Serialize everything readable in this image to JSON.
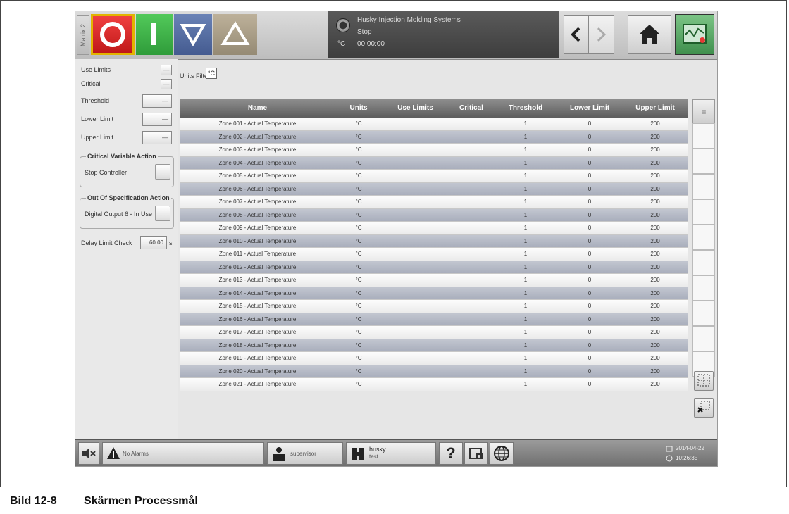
{
  "topbar": {
    "machine": "Matrix 2",
    "status_unit": "°C",
    "status_company": "Husky Injection Molding Systems",
    "status_state": "Stop",
    "status_time": "00:00:00"
  },
  "left": {
    "use_limits": "Use Limits",
    "critical": "Critical",
    "threshold": "Threshold",
    "lower_limit": "Lower Limit",
    "upper_limit": "Upper Limit",
    "dash": "—",
    "critical_action_title": "Critical Variable Action",
    "critical_action_value": "Stop Controller",
    "oos_action_title": "Out Of Specification Action",
    "oos_action_value": "Digital Output 6 - In Use",
    "delay_label": "Delay Limit Check",
    "delay_value": "60.00",
    "delay_unit": "s"
  },
  "filter": {
    "label": "Units Filter",
    "value": "°C"
  },
  "table": {
    "headers": [
      "Name",
      "Units",
      "Use Limits",
      "Critical",
      "Threshold",
      "Lower Limit",
      "Upper Limit"
    ],
    "rows": [
      {
        "name": "Zone 001 - Actual Temperature",
        "units": "°C",
        "threshold": "1",
        "lower": "0",
        "upper": "200"
      },
      {
        "name": "Zone 002 - Actual Temperature",
        "units": "°C",
        "threshold": "1",
        "lower": "0",
        "upper": "200"
      },
      {
        "name": "Zone 003 - Actual Temperature",
        "units": "°C",
        "threshold": "1",
        "lower": "0",
        "upper": "200"
      },
      {
        "name": "Zone 004 - Actual Temperature",
        "units": "°C",
        "threshold": "1",
        "lower": "0",
        "upper": "200"
      },
      {
        "name": "Zone 005 - Actual Temperature",
        "units": "°C",
        "threshold": "1",
        "lower": "0",
        "upper": "200"
      },
      {
        "name": "Zone 006 - Actual Temperature",
        "units": "°C",
        "threshold": "1",
        "lower": "0",
        "upper": "200"
      },
      {
        "name": "Zone 007 - Actual Temperature",
        "units": "°C",
        "threshold": "1",
        "lower": "0",
        "upper": "200"
      },
      {
        "name": "Zone 008 - Actual Temperature",
        "units": "°C",
        "threshold": "1",
        "lower": "0",
        "upper": "200"
      },
      {
        "name": "Zone 009 - Actual Temperature",
        "units": "°C",
        "threshold": "1",
        "lower": "0",
        "upper": "200"
      },
      {
        "name": "Zone 010 - Actual Temperature",
        "units": "°C",
        "threshold": "1",
        "lower": "0",
        "upper": "200"
      },
      {
        "name": "Zone 011 - Actual Temperature",
        "units": "°C",
        "threshold": "1",
        "lower": "0",
        "upper": "200"
      },
      {
        "name": "Zone 012 - Actual Temperature",
        "units": "°C",
        "threshold": "1",
        "lower": "0",
        "upper": "200"
      },
      {
        "name": "Zone 013 - Actual Temperature",
        "units": "°C",
        "threshold": "1",
        "lower": "0",
        "upper": "200"
      },
      {
        "name": "Zone 014 - Actual Temperature",
        "units": "°C",
        "threshold": "1",
        "lower": "0",
        "upper": "200"
      },
      {
        "name": "Zone 015 - Actual Temperature",
        "units": "°C",
        "threshold": "1",
        "lower": "0",
        "upper": "200"
      },
      {
        "name": "Zone 016 - Actual Temperature",
        "units": "°C",
        "threshold": "1",
        "lower": "0",
        "upper": "200"
      },
      {
        "name": "Zone 017 - Actual Temperature",
        "units": "°C",
        "threshold": "1",
        "lower": "0",
        "upper": "200"
      },
      {
        "name": "Zone 018 - Actual Temperature",
        "units": "°C",
        "threshold": "1",
        "lower": "0",
        "upper": "200"
      },
      {
        "name": "Zone 019 - Actual Temperature",
        "units": "°C",
        "threshold": "1",
        "lower": "0",
        "upper": "200"
      },
      {
        "name": "Zone 020 - Actual Temperature",
        "units": "°C",
        "threshold": "1",
        "lower": "0",
        "upper": "200"
      },
      {
        "name": "Zone 021 - Actual Temperature",
        "units": "°C",
        "threshold": "1",
        "lower": "0",
        "upper": "200"
      }
    ]
  },
  "bottombar": {
    "alarms": "No Alarms",
    "user": "supervisor",
    "mold_name": "husky",
    "mold_sub": "test",
    "date": "2014-04-22",
    "time": "10:26:35"
  },
  "caption": {
    "number": "Bild 12-8",
    "title": "Skärmen Processmål"
  }
}
